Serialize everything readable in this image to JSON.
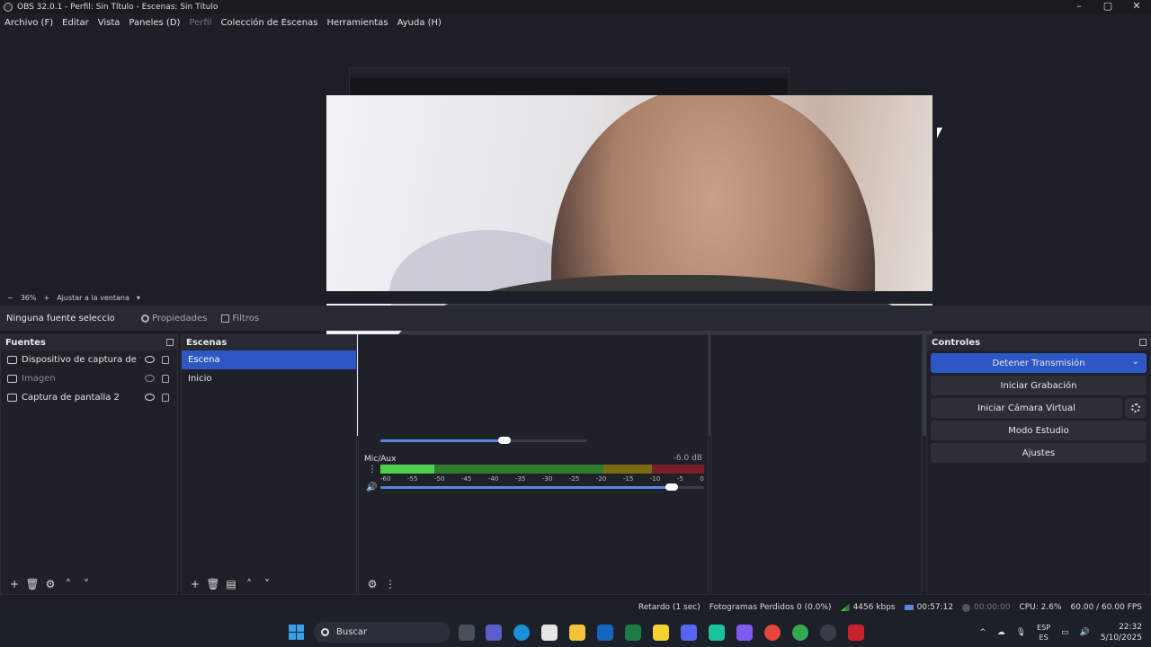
{
  "window": {
    "title": "OBS 32.0.1 - Perfil: Sin Título - Escenas: Sin Título",
    "controls": [
      "minimize-icon",
      "maximize-icon",
      "close-icon"
    ]
  },
  "menu": {
    "items": [
      {
        "label": "Archivo (F)",
        "enabled": true
      },
      {
        "label": "Editar",
        "enabled": true
      },
      {
        "label": "Vista",
        "enabled": true
      },
      {
        "label": "Paneles (D)",
        "enabled": true
      },
      {
        "label": "Perfil",
        "enabled": false
      },
      {
        "label": "Colección de Escenas",
        "enabled": true
      },
      {
        "label": "Herramientas",
        "enabled": true
      },
      {
        "label": "Ayuda (H)",
        "enabled": true
      }
    ]
  },
  "zoom": {
    "minus": "−",
    "value": "36%",
    "plus": "+",
    "fit_label": "Ajustar a la ventana"
  },
  "source_toolbar": {
    "no_selection": "Ninguna fuente seleccionada",
    "properties": "Propiedades",
    "filters": "Filtros"
  },
  "fuentes": {
    "title": "Fuentes",
    "items": [
      {
        "label": "Dispositivo de captura de video",
        "icon": "camera-icon",
        "visible": true
      },
      {
        "label": "Imagen",
        "icon": "image-icon",
        "visible": false
      },
      {
        "label": "Captura de pantalla 2",
        "icon": "monitor-icon",
        "visible": true
      }
    ]
  },
  "escenas": {
    "title": "Escenas",
    "items": [
      {
        "label": "Escena",
        "selected": true
      },
      {
        "label": "Inicio",
        "selected": false
      }
    ]
  },
  "mixer": {
    "channel": {
      "name": "Mic/Aux",
      "db": "-6.0 dB",
      "level_db": -50,
      "volume_fraction": 0.9,
      "ticks": [
        "-60",
        "-55",
        "-50",
        "-45",
        "-40",
        "-35",
        "-30",
        "-25",
        "-20",
        "-15",
        "-10",
        "-5",
        "0"
      ]
    },
    "prev_channel_volume_fraction": 0.6
  },
  "controles": {
    "title": "Controles",
    "stop_stream": "Detener Transmisión",
    "start_recording": "Iniciar Grabación",
    "start_virtualcam": "Iniciar Cámara Virtual",
    "studio_mode": "Modo Estudio",
    "settings": "Ajustes"
  },
  "status": {
    "delay": "Retardo (1 sec)",
    "dropped": "Fotogramas Perdidos 0 (0.0%)",
    "bitrate": "4456 kbps",
    "stream_time": "00:57:12",
    "rec_time": "00:00:00",
    "cpu": "CPU: 2.6%",
    "fps": "60.00 / 60.00 FPS"
  },
  "taskbar": {
    "search": "Buscar",
    "lang_top": "ESP",
    "lang_bottom": "ES",
    "time": "22:32",
    "date": "5/10/2025"
  }
}
